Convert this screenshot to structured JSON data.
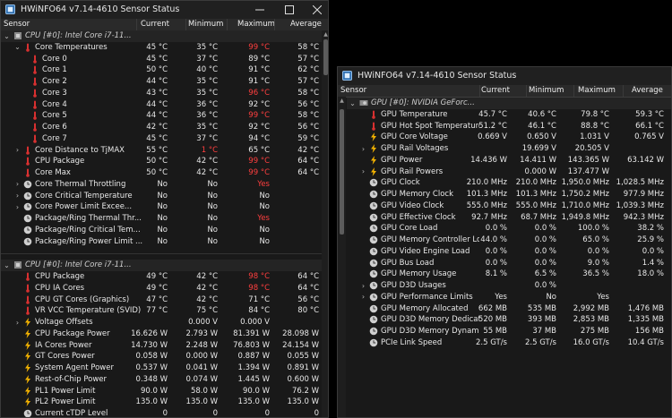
{
  "window_a": {
    "title": "HWiNFO64 v7.14-4610 Sensor Status",
    "columns": {
      "sensor": "Sensor",
      "current": "Current",
      "minimum": "Minimum",
      "maximum": "Maximum",
      "average": "Average"
    },
    "rows": [
      {
        "type": "section",
        "expand": "⌄",
        "icon": "cpu",
        "label": "CPU [#0]: Intel Core i7-11..."
      },
      {
        "type": "data",
        "indent": 1,
        "expand": "⌄",
        "icon": "thermometer",
        "label": "Core Temperatures",
        "cur": "45 °C",
        "min": "35 °C",
        "max": "99 °C",
        "avg": "58 °C",
        "max_red": true
      },
      {
        "type": "data",
        "indent": 2,
        "icon": "thermometer",
        "label": "Core 0",
        "cur": "45 °C",
        "min": "37 °C",
        "max": "89 °C",
        "avg": "57 °C"
      },
      {
        "type": "data",
        "indent": 2,
        "icon": "thermometer",
        "label": "Core 1",
        "cur": "50 °C",
        "min": "40 °C",
        "max": "91 °C",
        "avg": "62 °C"
      },
      {
        "type": "data",
        "indent": 2,
        "icon": "thermometer",
        "label": "Core 2",
        "cur": "44 °C",
        "min": "35 °C",
        "max": "91 °C",
        "avg": "57 °C"
      },
      {
        "type": "data",
        "indent": 2,
        "icon": "thermometer",
        "label": "Core 3",
        "cur": "43 °C",
        "min": "35 °C",
        "max": "96 °C",
        "avg": "58 °C",
        "max_red": true
      },
      {
        "type": "data",
        "indent": 2,
        "icon": "thermometer",
        "label": "Core 4",
        "cur": "44 °C",
        "min": "36 °C",
        "max": "92 °C",
        "avg": "56 °C"
      },
      {
        "type": "data",
        "indent": 2,
        "icon": "thermometer",
        "label": "Core 5",
        "cur": "44 °C",
        "min": "36 °C",
        "max": "99 °C",
        "avg": "58 °C",
        "max_red": true
      },
      {
        "type": "data",
        "indent": 2,
        "icon": "thermometer",
        "label": "Core 6",
        "cur": "42 °C",
        "min": "35 °C",
        "max": "92 °C",
        "avg": "56 °C"
      },
      {
        "type": "data",
        "indent": 2,
        "icon": "thermometer",
        "label": "Core 7",
        "cur": "45 °C",
        "min": "37 °C",
        "max": "94 °C",
        "avg": "59 °C"
      },
      {
        "type": "data",
        "indent": 1,
        "expand": "›",
        "icon": "thermometer",
        "label": "Core Distance to TjMAX",
        "cur": "55 °C",
        "min": "1 °C",
        "max": "65 °C",
        "avg": "42 °C",
        "min_red": true
      },
      {
        "type": "data",
        "indent": 1,
        "icon": "thermometer",
        "label": "CPU Package",
        "cur": "50 °C",
        "min": "42 °C",
        "max": "99 °C",
        "avg": "64 °C",
        "max_red": true
      },
      {
        "type": "data",
        "indent": 1,
        "icon": "thermometer",
        "label": "Core Max",
        "cur": "50 °C",
        "min": "42 °C",
        "max": "99 °C",
        "avg": "64 °C",
        "max_red": true
      },
      {
        "type": "data",
        "indent": 1,
        "expand": "›",
        "icon": "clock",
        "label": "Core Thermal Throttling",
        "cur": "No",
        "min": "No",
        "max": "Yes",
        "avg": "",
        "max_red": true
      },
      {
        "type": "data",
        "indent": 1,
        "expand": "›",
        "icon": "clock",
        "label": "Core Critical Temperature",
        "cur": "No",
        "min": "No",
        "max": "No",
        "avg": ""
      },
      {
        "type": "data",
        "indent": 1,
        "expand": "›",
        "icon": "clock",
        "label": "Core Power Limit Excee...",
        "cur": "No",
        "min": "No",
        "max": "No",
        "avg": ""
      },
      {
        "type": "data",
        "indent": 1,
        "icon": "clock",
        "label": "Package/Ring Thermal Thr...",
        "cur": "No",
        "min": "No",
        "max": "Yes",
        "avg": "",
        "max_red": true
      },
      {
        "type": "data",
        "indent": 1,
        "icon": "clock",
        "label": "Package/Ring Critical Tem...",
        "cur": "No",
        "min": "No",
        "max": "No",
        "avg": ""
      },
      {
        "type": "data",
        "indent": 1,
        "icon": "clock",
        "label": "Package/Ring Power Limit ...",
        "cur": "No",
        "min": "No",
        "max": "No",
        "avg": ""
      },
      {
        "type": "gap"
      },
      {
        "type": "section",
        "expand": "⌄",
        "icon": "cpu",
        "label": "CPU [#0]: Intel Core i7-11..."
      },
      {
        "type": "data",
        "indent": 1,
        "icon": "thermometer",
        "label": "CPU Package",
        "cur": "49 °C",
        "min": "42 °C",
        "max": "98 °C",
        "avg": "64 °C",
        "max_red": true
      },
      {
        "type": "data",
        "indent": 1,
        "icon": "thermometer",
        "label": "CPU IA Cores",
        "cur": "49 °C",
        "min": "42 °C",
        "max": "98 °C",
        "avg": "64 °C",
        "max_red": true
      },
      {
        "type": "data",
        "indent": 1,
        "icon": "thermometer",
        "label": "CPU GT Cores (Graphics)",
        "cur": "47 °C",
        "min": "42 °C",
        "max": "71 °C",
        "avg": "56 °C"
      },
      {
        "type": "data",
        "indent": 1,
        "icon": "thermometer",
        "label": "VR VCC Temperature (SVID)",
        "cur": "77 °C",
        "min": "75 °C",
        "max": "84 °C",
        "avg": "80 °C"
      },
      {
        "type": "data",
        "indent": 1,
        "expand": "›",
        "icon": "bolt",
        "label": "Voltage Offsets",
        "cur": "",
        "min": "0.000 V",
        "max": "0.000 V",
        "avg": ""
      },
      {
        "type": "data",
        "indent": 1,
        "icon": "bolt",
        "label": "CPU Package Power",
        "cur": "16.626 W",
        "min": "2.793 W",
        "max": "81.391 W",
        "avg": "28.098 W"
      },
      {
        "type": "data",
        "indent": 1,
        "icon": "bolt",
        "label": "IA Cores Power",
        "cur": "14.730 W",
        "min": "2.248 W",
        "max": "76.803 W",
        "avg": "24.154 W"
      },
      {
        "type": "data",
        "indent": 1,
        "icon": "bolt",
        "label": "GT Cores Power",
        "cur": "0.058 W",
        "min": "0.000 W",
        "max": "0.887 W",
        "avg": "0.055 W"
      },
      {
        "type": "data",
        "indent": 1,
        "icon": "bolt",
        "label": "System Agent Power",
        "cur": "0.537 W",
        "min": "0.041 W",
        "max": "1.394 W",
        "avg": "0.891 W"
      },
      {
        "type": "data",
        "indent": 1,
        "icon": "bolt",
        "label": "Rest-of-Chip Power",
        "cur": "0.348 W",
        "min": "0.074 W",
        "max": "1.445 W",
        "avg": "0.600 W"
      },
      {
        "type": "data",
        "indent": 1,
        "icon": "bolt",
        "label": "PL1 Power Limit",
        "cur": "90.0 W",
        "min": "58.0 W",
        "max": "90.0 W",
        "avg": "76.2 W"
      },
      {
        "type": "data",
        "indent": 1,
        "icon": "bolt",
        "label": "PL2 Power Limit",
        "cur": "135.0 W",
        "min": "135.0 W",
        "max": "135.0 W",
        "avg": "135.0 W"
      },
      {
        "type": "data",
        "indent": 1,
        "icon": "clock",
        "label": "Current cTDP Level",
        "cur": "0",
        "min": "0",
        "max": "0",
        "avg": "0"
      }
    ]
  },
  "window_b": {
    "title": "HWiNFO64 v7.14-4610 Sensor Status",
    "columns": {
      "sensor": "Sensor",
      "current": "Current",
      "minimum": "Minimum",
      "maximum": "Maximum",
      "average": "Average"
    },
    "rows": [
      {
        "type": "section",
        "expand": "⌄",
        "icon": "gpu",
        "label": "GPU [#0]: NVIDIA GeForc..."
      },
      {
        "type": "data",
        "indent": 1,
        "icon": "thermometer",
        "label": "GPU Temperature",
        "cur": "45.7 °C",
        "min": "40.6 °C",
        "max": "79.8 °C",
        "avg": "59.3 °C"
      },
      {
        "type": "data",
        "indent": 1,
        "icon": "thermometer",
        "label": "GPU Hot Spot Temperature",
        "cur": "51.2 °C",
        "min": "46.1 °C",
        "max": "88.8 °C",
        "avg": "66.1 °C"
      },
      {
        "type": "data",
        "indent": 1,
        "icon": "bolt",
        "label": "GPU Core Voltage",
        "cur": "0.669 V",
        "min": "0.650 V",
        "max": "1.031 V",
        "avg": "0.765 V"
      },
      {
        "type": "data",
        "indent": 1,
        "expand": "›",
        "icon": "bolt",
        "label": "GPU Rail Voltages",
        "cur": "",
        "min": "19.699 V",
        "max": "20.505 V",
        "avg": ""
      },
      {
        "type": "data",
        "indent": 1,
        "icon": "bolt",
        "label": "GPU Power",
        "cur": "14.436 W",
        "min": "14.411 W",
        "max": "143.365 W",
        "avg": "63.142 W"
      },
      {
        "type": "data",
        "indent": 1,
        "expand": "›",
        "icon": "bolt",
        "label": "GPU Rail Powers",
        "cur": "",
        "min": "0.000 W",
        "max": "137.477 W",
        "avg": ""
      },
      {
        "type": "data",
        "indent": 1,
        "icon": "clock",
        "label": "GPU Clock",
        "cur": "210.0 MHz",
        "min": "210.0 MHz",
        "max": "1,950.0 MHz",
        "avg": "1,028.5 MHz"
      },
      {
        "type": "data",
        "indent": 1,
        "icon": "clock",
        "label": "GPU Memory Clock",
        "cur": "101.3 MHz",
        "min": "101.3 MHz",
        "max": "1,750.2 MHz",
        "avg": "977.9 MHz"
      },
      {
        "type": "data",
        "indent": 1,
        "icon": "clock",
        "label": "GPU Video Clock",
        "cur": "555.0 MHz",
        "min": "555.0 MHz",
        "max": "1,710.0 MHz",
        "avg": "1,039.3 MHz"
      },
      {
        "type": "data",
        "indent": 1,
        "icon": "clock",
        "label": "GPU Effective Clock",
        "cur": "92.7 MHz",
        "min": "68.7 MHz",
        "max": "1,949.8 MHz",
        "avg": "942.3 MHz"
      },
      {
        "type": "data",
        "indent": 1,
        "icon": "clock",
        "label": "GPU Core Load",
        "cur": "0.0 %",
        "min": "0.0 %",
        "max": "100.0 %",
        "avg": "38.2 %"
      },
      {
        "type": "data",
        "indent": 1,
        "icon": "clock",
        "label": "GPU Memory Controller Lo...",
        "cur": "44.0 %",
        "min": "0.0 %",
        "max": "65.0 %",
        "avg": "25.9 %"
      },
      {
        "type": "data",
        "indent": 1,
        "icon": "clock",
        "label": "GPU Video Engine Load",
        "cur": "0.0 %",
        "min": "0.0 %",
        "max": "0.0 %",
        "avg": "0.0 %"
      },
      {
        "type": "data",
        "indent": 1,
        "icon": "clock",
        "label": "GPU Bus Load",
        "cur": "0.0 %",
        "min": "0.0 %",
        "max": "9.0 %",
        "avg": "1.4 %"
      },
      {
        "type": "data",
        "indent": 1,
        "icon": "clock",
        "label": "GPU Memory Usage",
        "cur": "8.1 %",
        "min": "6.5 %",
        "max": "36.5 %",
        "avg": "18.0 %"
      },
      {
        "type": "data",
        "indent": 1,
        "expand": "›",
        "icon": "clock",
        "label": "GPU D3D Usages",
        "cur": "",
        "min": "0.0 %",
        "max": "",
        "avg": ""
      },
      {
        "type": "data",
        "indent": 1,
        "expand": "›",
        "icon": "clock",
        "label": "GPU Performance Limits",
        "cur": "Yes",
        "min": "No",
        "max": "Yes",
        "avg": ""
      },
      {
        "type": "data",
        "indent": 1,
        "icon": "clock",
        "label": "GPU Memory Allocated",
        "cur": "662 MB",
        "min": "535 MB",
        "max": "2,992 MB",
        "avg": "1,476 MB"
      },
      {
        "type": "data",
        "indent": 1,
        "icon": "clock",
        "label": "GPU D3D Memory Dedicated",
        "cur": "520 MB",
        "min": "393 MB",
        "max": "2,853 MB",
        "avg": "1,335 MB"
      },
      {
        "type": "data",
        "indent": 1,
        "icon": "clock",
        "label": "GPU D3D Memory Dynamic",
        "cur": "55 MB",
        "min": "37 MB",
        "max": "275 MB",
        "avg": "156 MB"
      },
      {
        "type": "data",
        "indent": 1,
        "icon": "clock",
        "label": "PCIe Link Speed",
        "cur": "2.5 GT/s",
        "min": "2.5 GT/s",
        "max": "16.0 GT/s",
        "avg": "10.4 GT/s"
      }
    ]
  },
  "colors": {
    "red_value": "#ff3f3f",
    "bolt": "#f5b400",
    "thermometer": "#d83030",
    "clock": "#bdbdbd"
  }
}
